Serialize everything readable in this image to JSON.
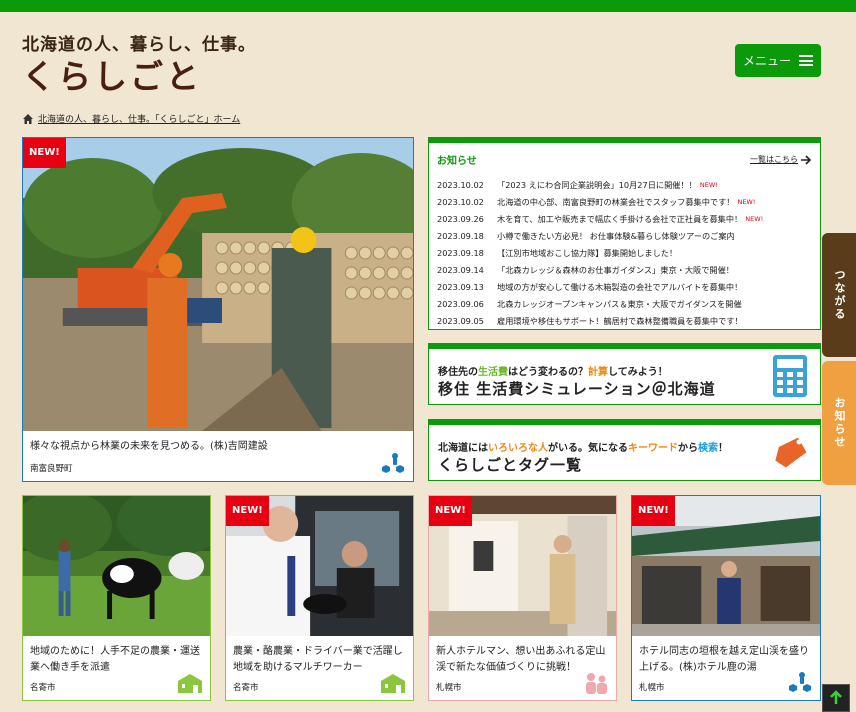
{
  "header": {
    "logo_sub": "北海道の人、暮らし、仕事。",
    "logo_main": "くらしごと",
    "menu_label": "メニュー",
    "colors": {
      "accent": "#0a9a0a",
      "brand": "#4a1f10",
      "new": "#e60012"
    }
  },
  "breadcrumb": {
    "text": "北海道の人、暮らし、仕事。「くらしごと」ホーム"
  },
  "featured": {
    "badge": "NEW!",
    "caption": "様々な視点から林業の未来を見つめる。(株)吉岡建設",
    "place": "南富良野町",
    "tag_icon": "tsunagaru-icon"
  },
  "news": {
    "title": "お知らせ",
    "more": "一覧はこちら",
    "items": [
      {
        "date": "2023.10.02",
        "text": "「2023 えにわ合同企業説明会」10月27日に開催！！",
        "new": "NEW!"
      },
      {
        "date": "2023.10.02",
        "text": "北海道の中心部、南富良野町の林業会社でスタッフ募集中です！",
        "new": "NEW!"
      },
      {
        "date": "2023.09.26",
        "text": "木を育て、加工や販売まで幅広く手掛ける会社で正社員を募集中！",
        "new": "NEW!"
      },
      {
        "date": "2023.09.18",
        "text": "小樽で働きたい方必見！ お仕事体験&暮らし体験ツアーのご案内",
        "new": ""
      },
      {
        "date": "2023.09.18",
        "text": "【江別市地域おこし協力隊】募集開始しました！",
        "new": ""
      },
      {
        "date": "2023.09.14",
        "text": "「北森カレッジ＆森林のお仕事ガイダンス」東京・大阪で開催！",
        "new": ""
      },
      {
        "date": "2023.09.13",
        "text": "地域の方が安心して働ける木箱製造の会社でアルバイトを募集中！",
        "new": ""
      },
      {
        "date": "2023.09.06",
        "text": "北森カレッジオープンキャンパス＆東京・大阪でガイダンスを開催",
        "new": ""
      },
      {
        "date": "2023.09.05",
        "text": "雇用環境や移住もサポート！鶴居村で森林整備職員を募集中です！",
        "new": ""
      }
    ]
  },
  "banner_sim": {
    "l1_a": "移住先の",
    "l1_b": "生活費",
    "l1_c": "はどう変わるの？",
    "l1_d": "計算",
    "l1_e": "してみよう！",
    "l2": "移住 生活費シミュレーション＠北海道",
    "icon": "calculator-icon"
  },
  "banner_tag": {
    "l1_a": "北海道には",
    "l1_b": "いろいろな人",
    "l1_c": "がいる。気になる",
    "l1_d": "キーワード",
    "l1_e": "から",
    "l1_f": "検索",
    "l1_g": "！",
    "l2": "くらしごとタグ一覧",
    "icon": "tag-icon"
  },
  "cards": [
    {
      "badge": "",
      "caption": "地域のために！人手不足の農業・運送業へ働き手を派遣",
      "place": "名寄市"
    },
    {
      "badge": "NEW!",
      "caption": "農業・酪農業・ドライバー業で活躍し地域を助けるマルチワーカー",
      "place": "名寄市"
    },
    {
      "badge": "NEW!",
      "caption": "新人ホテルマン、想い出あふれる定山渓で新たな価値づくりに挑戦！",
      "place": "札幌市"
    },
    {
      "badge": "NEW!",
      "caption": "ホテル同志の垣根を越え定山渓を盛り上げる。(株)ホテル鹿の湯",
      "place": "札幌市"
    }
  ],
  "side": {
    "tab1": "つながる",
    "tab2": "お知らせ"
  }
}
